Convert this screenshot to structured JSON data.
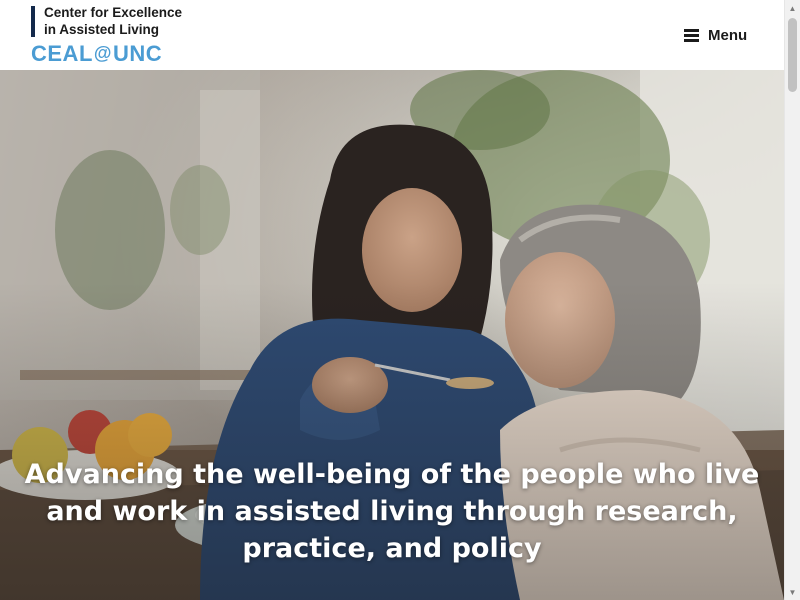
{
  "header": {
    "logo": {
      "line1": "Center for Excellence",
      "line2": "in Assisted Living",
      "brand_left": "CEAL",
      "brand_at": "@",
      "brand_right": "UNC"
    },
    "menu": {
      "label": "Menu",
      "icon": "hamburger-icon"
    }
  },
  "hero": {
    "headline": "Advancing the well-being of the people who live and work in assisted living through research, practice, and policy",
    "image_alt": "Caregiver feeding an older woman with a spoon at a table"
  },
  "colors": {
    "brand_blue": "#4b9cd3",
    "navy": "#13294b",
    "text_dark": "#1b1b1b"
  },
  "scrollbar": {
    "up_icon": "arrow-up-icon",
    "down_icon": "arrow-down-icon"
  }
}
